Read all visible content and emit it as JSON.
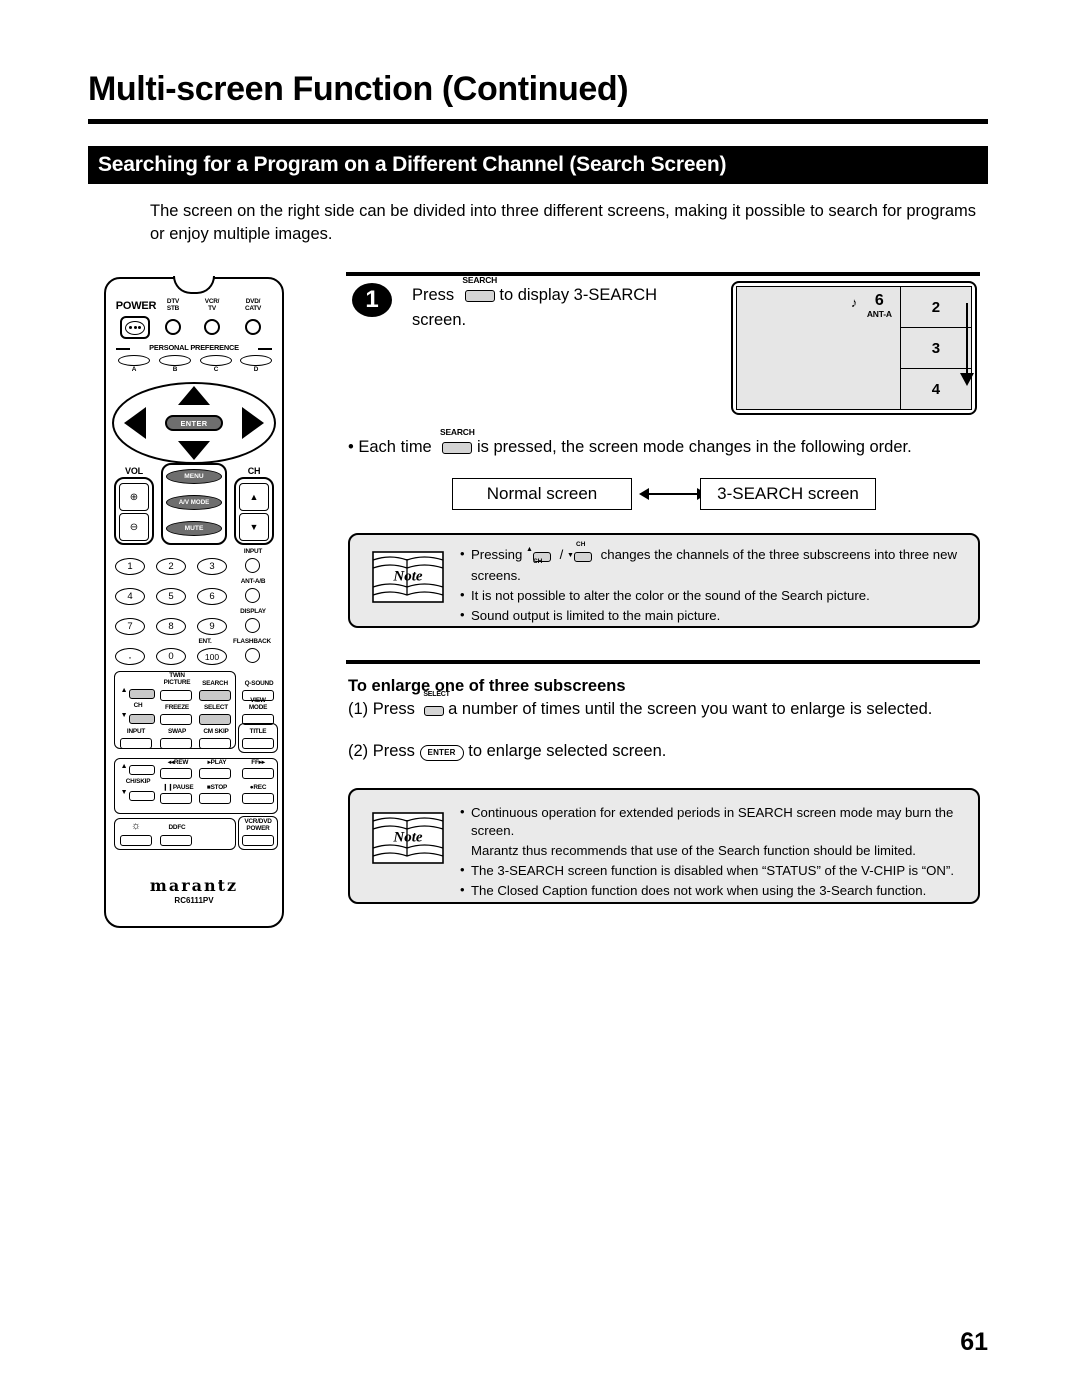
{
  "document": {
    "title": "Multi-screen Function (Continued)",
    "section_bar": "Searching for a Program on a Different Channel (Search Screen)",
    "intro": "The screen on the right side can be divided into three different screens, making it possible to search for programs or enjoy multiple images.",
    "page_number": "61"
  },
  "step1": {
    "number": "1",
    "text_before": "Press",
    "key_label": "SEARCH",
    "text_after": "to display 3-SEARCH screen."
  },
  "each_time": {
    "bullet": "•",
    "text_before": "Each time",
    "key_label": "SEARCH",
    "text_after": "is pressed, the screen mode changes in the following order."
  },
  "tv_diagram": {
    "main_channel": "6",
    "main_antenna": "ANT-A",
    "music_note": "♪",
    "subscreens": [
      "2",
      "3",
      "4"
    ]
  },
  "flow": {
    "left_box": "Normal screen",
    "right_box": "3-SEARCH screen"
  },
  "note1": {
    "label": "Note",
    "items": [
      {
        "text_before": "Pressing",
        "key_up_mark": "▲",
        "key_up_label": "CH",
        "separator": "/",
        "key_down_mark": "▼",
        "key_down_label": "CH",
        "text_after": "changes the channels of the three subscreens into three new screens."
      },
      {
        "text": "It is not possible to alter the color or the sound of the Search picture."
      },
      {
        "text": "Sound output is limited to the main picture."
      }
    ]
  },
  "enlarge_section": {
    "heading": "To enlarge one of three subscreens",
    "step1_prefix": "(1) Press",
    "step1_key": "SELECT",
    "step1_suffix": "a number of times until the screen you want to enlarge is selected.",
    "step2_prefix": "(2) Press",
    "step2_key": "ENTER",
    "step2_suffix": "to enlarge selected screen."
  },
  "note2": {
    "label": "Note",
    "items": [
      {
        "text": "Continuous operation for extended periods in SEARCH screen mode may burn the screen."
      },
      {
        "text": "Marantz thus recommends that use of the Search function should be limited.",
        "sub": true
      },
      {
        "text": "The 3-SEARCH screen function is disabled when “STATUS” of the V-CHIP is “ON”."
      },
      {
        "text": "The Closed Caption function does not work when using the 3-Search function."
      }
    ]
  },
  "remote": {
    "brand": "marantz",
    "model": "RC6111PV",
    "power": "POWER",
    "sources": [
      "DTV STB",
      "VCR/ TV",
      "DVD/ CATV"
    ],
    "source_lines": [
      [
        "DTV",
        "STB"
      ],
      [
        "VCR/",
        "TV"
      ],
      [
        "DVD/",
        "CATV"
      ]
    ],
    "personal_preference": "PERSONAL PREFERENCE",
    "preference_keys": [
      "A",
      "B",
      "C",
      "D"
    ],
    "enter": "ENTER",
    "vol": "VOL",
    "ch": "CH",
    "menu": "MENU",
    "av_mode": "A/V MODE",
    "mute": "MUTE",
    "numbers": [
      "1",
      "2",
      "3",
      "4",
      "5",
      "6",
      "7",
      "8",
      "9",
      "·",
      "0",
      "100"
    ],
    "side_keys": [
      "INPUT",
      "ANT-A/B",
      "DISPLAY",
      "FLASHBACK"
    ],
    "ent_label": "ENT.",
    "func_rows": [
      [
        "TWIN PICTURE",
        "SEARCH",
        "Q-SOUND"
      ],
      [
        "FREEZE",
        "SELECT",
        "VIEW MODE"
      ],
      [
        "INPUT",
        "SWAP",
        "CM SKIP",
        "TITLE"
      ]
    ],
    "twin_line1": "TWIN",
    "twin_line2": "PICTURE",
    "view_line1": "VIEW",
    "view_line2": "MODE",
    "ch_small": "CH",
    "ch_skip": "CH/SKIP",
    "transport": [
      "REW",
      "PLAY",
      "FF",
      "PAUSE",
      "STOP",
      "REC"
    ],
    "ddfc": "DDFC",
    "vcr_dvd_power_line1": "VCR/DVD",
    "vcr_dvd_power_line2": "POWER",
    "light_icon": "☼"
  }
}
